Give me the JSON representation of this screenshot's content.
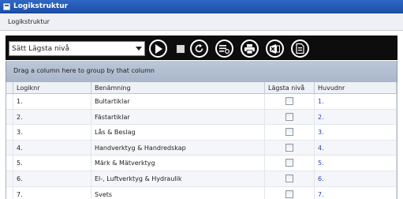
{
  "window": {
    "title": "Logikstruktur"
  },
  "panel": {
    "title": "Logikstruktur"
  },
  "toolbar": {
    "level_select_value": "Sätt Lägsta nivå",
    "icons": [
      "play-icon",
      "stop-icon",
      "refresh-icon",
      "list-settings-icon",
      "print-icon",
      "excel-export-icon",
      "document-icon"
    ]
  },
  "grid": {
    "group_hint": "Drag a column here to group by that column",
    "columns": [
      "Logiknr",
      "Benämning",
      "Lägsta nivå",
      "Huvudnr"
    ],
    "rows": [
      {
        "logiknr": "1.",
        "benamning": "Bultartiklar",
        "lagsta_niva": false,
        "huvudnr": "1."
      },
      {
        "logiknr": "2.",
        "benamning": "Fästartiklar",
        "lagsta_niva": false,
        "huvudnr": "2."
      },
      {
        "logiknr": "3.",
        "benamning": "Lås & Beslag",
        "lagsta_niva": false,
        "huvudnr": "3."
      },
      {
        "logiknr": "4.",
        "benamning": "Handverktyg & Handredskap",
        "lagsta_niva": false,
        "huvudnr": "4."
      },
      {
        "logiknr": "5.",
        "benamning": "Märk & Mätverktyg",
        "lagsta_niva": false,
        "huvudnr": "5."
      },
      {
        "logiknr": "6.",
        "benamning": "El-, Luftverktyg & Hydraulik",
        "lagsta_niva": false,
        "huvudnr": "6."
      },
      {
        "logiknr": "7.",
        "benamning": "Svets",
        "lagsta_niva": false,
        "huvudnr": "7."
      }
    ]
  },
  "colors": {
    "titlebar": "#2f67c4",
    "toolbar": "#0d0d0d",
    "group_panel": "#b3bfd2",
    "link": "#2b3fb8"
  }
}
